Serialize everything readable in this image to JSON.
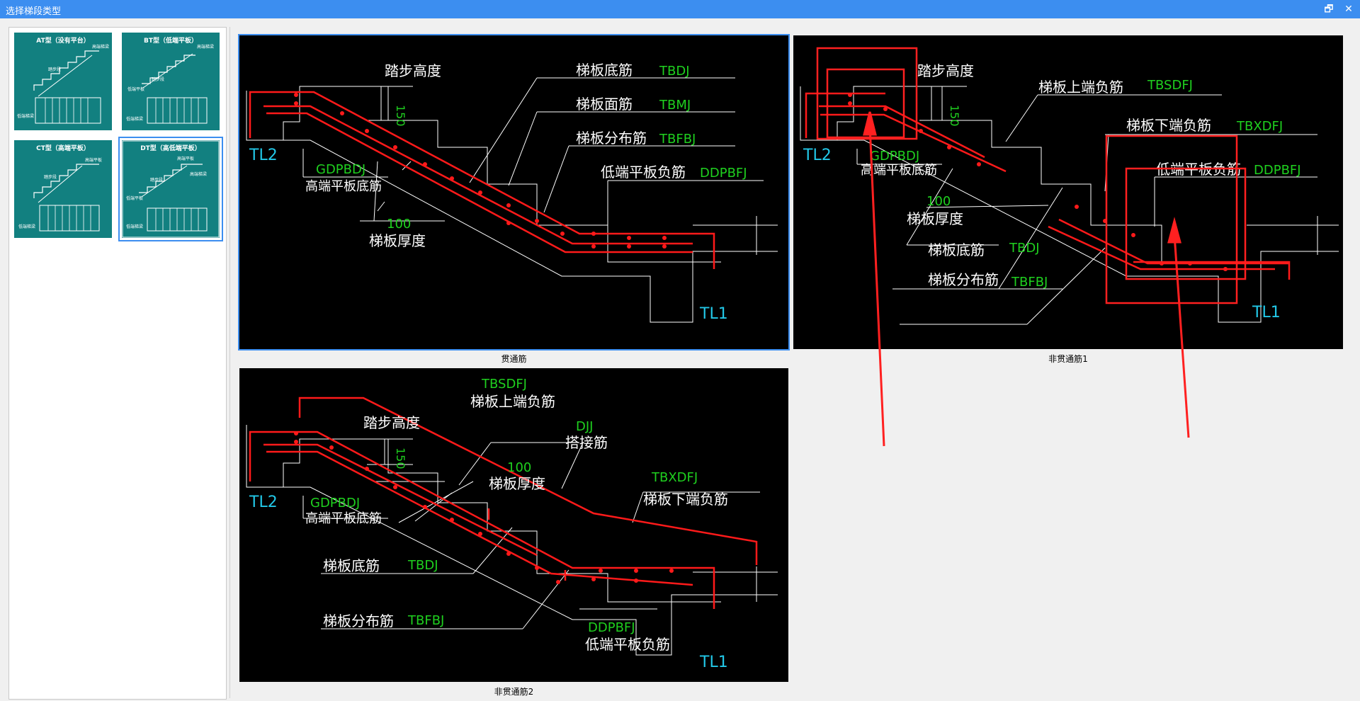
{
  "window": {
    "title": "选择梯段类型",
    "restore_symbol": "🗗",
    "close_symbol": "✕"
  },
  "thumbnails": [
    {
      "label": "AT型（没有平台）",
      "selected": false
    },
    {
      "label": "BT型（低端平板）",
      "selected": false
    },
    {
      "label": "CT型（高端平板）",
      "selected": false
    },
    {
      "label": "DT型（高低端平板）",
      "selected": true
    }
  ],
  "thumb_text": {
    "top_rebar": "高端梯梁",
    "bottom_rebar": "低端梯梁",
    "step": "踏步段",
    "platform": "高端平板",
    "low_platform": "低端平板"
  },
  "drawings": [
    {
      "caption": "贯通筋",
      "labels": {
        "step_height": "踏步高度",
        "h150": "150",
        "tl2": "TL2",
        "tl1": "TL1",
        "bottom_cn": "梯板底筋",
        "bottom_code": "TBDJ",
        "face_cn": "梯板面筋",
        "face_code": "TBMJ",
        "dist_cn": "梯板分布筋",
        "dist_code": "TBFBJ",
        "low_neg_cn": "低端平板负筋",
        "low_neg_code": "DDPBFJ",
        "high_bot_code": "GDPBDJ",
        "high_bot_cn": "高端平板底筋",
        "thick_val": "100",
        "thick_cn": "梯板厚度"
      }
    },
    {
      "caption": "非贯通筋1",
      "labels": {
        "step_height": "踏步高度",
        "h150": "150",
        "tl2": "TL2",
        "tl1": "TL1",
        "upper_neg_cn": "梯板上端负筋",
        "upper_neg_code": "TBSDFJ",
        "lower_neg_cn": "梯板下端负筋",
        "lower_neg_code": "TBXDFJ",
        "low_neg_cn": "低端平板负筋",
        "low_neg_code": "DDPBFJ",
        "high_bot_code": "GDPBDJ",
        "high_bot_cn": "高端平板底筋",
        "thick_val": "100",
        "thick_cn": "梯板厚度",
        "bottom_cn": "梯板底筋",
        "bottom_code": "TBDJ",
        "dist_cn": "梯板分布筋",
        "dist_code": "TBFBJ"
      }
    },
    {
      "caption": "非贯通筋2",
      "labels": {
        "step_height": "踏步高度",
        "h150": "150",
        "tl2": "TL2",
        "tl1": "TL1",
        "upper_neg_code": "TBSDFJ",
        "upper_neg_cn": "梯板上端负筋",
        "lap_code": "DJJ",
        "lap_cn": "搭接筋",
        "thick_val": "100",
        "thick_cn": "梯板厚度",
        "lower_neg_code": "TBXDFJ",
        "lower_neg_cn": "梯板下端负筋",
        "high_bot_code": "GDPBDJ",
        "high_bot_cn": "高端平板底筋",
        "bottom_cn": "梯板底筋",
        "bottom_code": "TBDJ",
        "dist_cn": "梯板分布筋",
        "dist_code": "TBFBJ",
        "low_neg_code": "DDPBFJ",
        "low_neg_cn": "低端平板负筋"
      }
    }
  ],
  "colors": {
    "title_bar": "#3c8ef0",
    "thumb_bg": "#128080",
    "cad_bg": "#000000",
    "rebar": "#ff1a1a",
    "code_green": "#1fd01f",
    "tl_cyan": "#22c8e8",
    "annotation": "#ff2020"
  }
}
